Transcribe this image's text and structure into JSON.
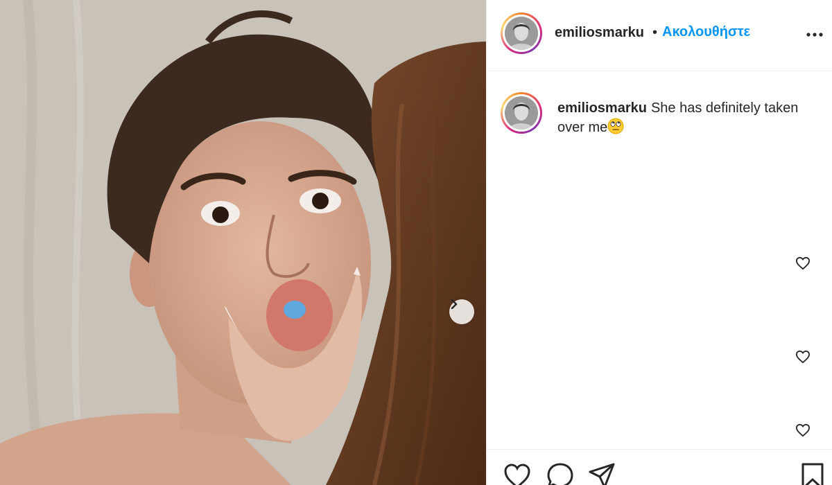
{
  "post": {
    "username": "emiliosmarku",
    "follow_label": "Ακολουθήστε",
    "separator": "•",
    "caption_text": "She has definitely taken over me",
    "caption_emoji": "face-with-rolling-eyes-emoji"
  },
  "photo": {
    "next_icon": "chevron-right-icon"
  },
  "icons": {
    "more": "more-options-icon",
    "comment_like": "heart-outline-icon",
    "actions": [
      "heart-outline-icon",
      "comment-icon",
      "share-icon",
      "bookmark-icon"
    ]
  },
  "colors": {
    "link_blue": "#0095f6",
    "text": "#262626",
    "border": "#efefef"
  }
}
